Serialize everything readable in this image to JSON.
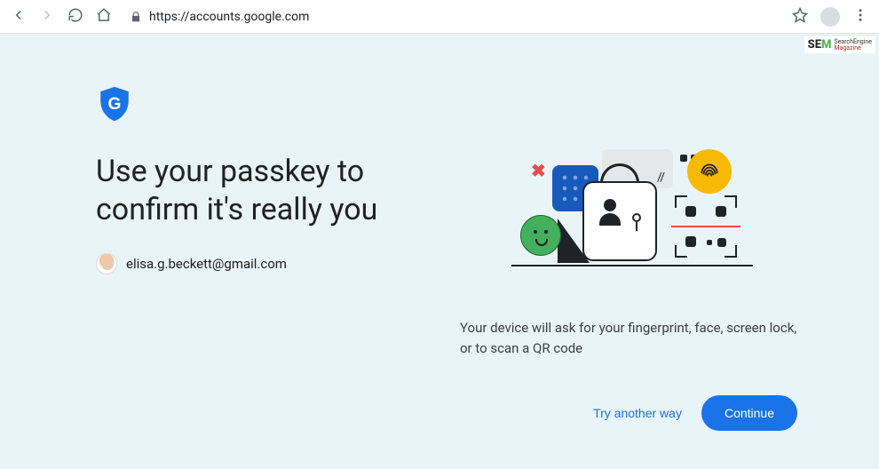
{
  "browser": {
    "url": "https://accounts.google.com"
  },
  "watermark": {
    "logo_s": "S",
    "logo_e": "E",
    "logo_m": "M",
    "line1": "SearchEngine",
    "line2": "Magazine"
  },
  "passkey": {
    "heading_line1": "Use your passkey to",
    "heading_line2": "confirm it's really you",
    "account_email": "elisa.g.beckett@gmail.com",
    "instruction": "Your device will ask for your fingerprint, face, screen lock, or to scan a QR code",
    "try_another_label": "Try another way",
    "continue_label": "Continue"
  }
}
